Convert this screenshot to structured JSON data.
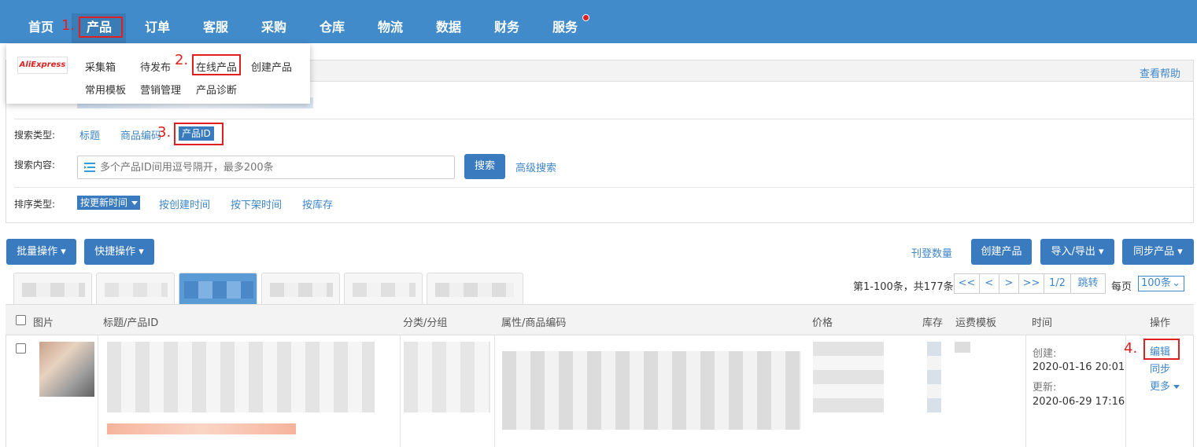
{
  "nav": {
    "items": [
      "首页",
      "产品",
      "订单",
      "客服",
      "采购",
      "仓库",
      "物流",
      "数据",
      "财务",
      "服务"
    ],
    "active": "产品",
    "badge_color": "#e02020"
  },
  "annotations": [
    "1.",
    "2.",
    "3.",
    "4."
  ],
  "dropdown": {
    "logo": "AliExpress",
    "items_row1": [
      "采集箱",
      "待发布",
      "在线产品",
      "创建产品"
    ],
    "items_row2": [
      "常用模板",
      "营销管理",
      "产品诊断"
    ]
  },
  "help_link": "查看帮助",
  "filter": {
    "search_type_label": "搜索类型:",
    "search_types": [
      "标题",
      "商品编码",
      "产品ID"
    ],
    "search_content_label": "搜索内容:",
    "search_placeholder": "多个产品ID间用逗号隔开，最多200条",
    "search_button": "搜索",
    "advanced_search": "高级搜索",
    "sort_label": "排序类型:",
    "sort_selected": "按更新时间",
    "sort_options": [
      "按创建时间",
      "按下架时间",
      "按库存"
    ]
  },
  "toolbar": {
    "batch": "批量操作",
    "quick": "快捷操作",
    "publish_count": "刊登数量",
    "create": "创建产品",
    "import_export": "导入/导出",
    "sync": "同步产品"
  },
  "pager": {
    "summary": "第1-100条，共177条",
    "first": "<<",
    "prev": "<",
    "next": ">",
    "last": ">>",
    "page": "1/2",
    "jump": "跳转",
    "per_page_label": "每页",
    "per_page": "100条"
  },
  "table": {
    "headers": [
      "图片",
      "标题/产品ID",
      "分类/分组",
      "属性/商品编码",
      "价格",
      "库存",
      "运费模板",
      "时间",
      "操作"
    ],
    "row": {
      "created_label": "创建:",
      "created": "2020-01-16 20:01",
      "updated_label": "更新:",
      "updated": "2020-06-29 17:16",
      "actions": [
        "编辑",
        "同步",
        "更多"
      ]
    }
  },
  "colors": {
    "primary": "#428bca",
    "button": "#3a7bbf",
    "annotation": "#e02020",
    "link": "#3f86c8"
  }
}
